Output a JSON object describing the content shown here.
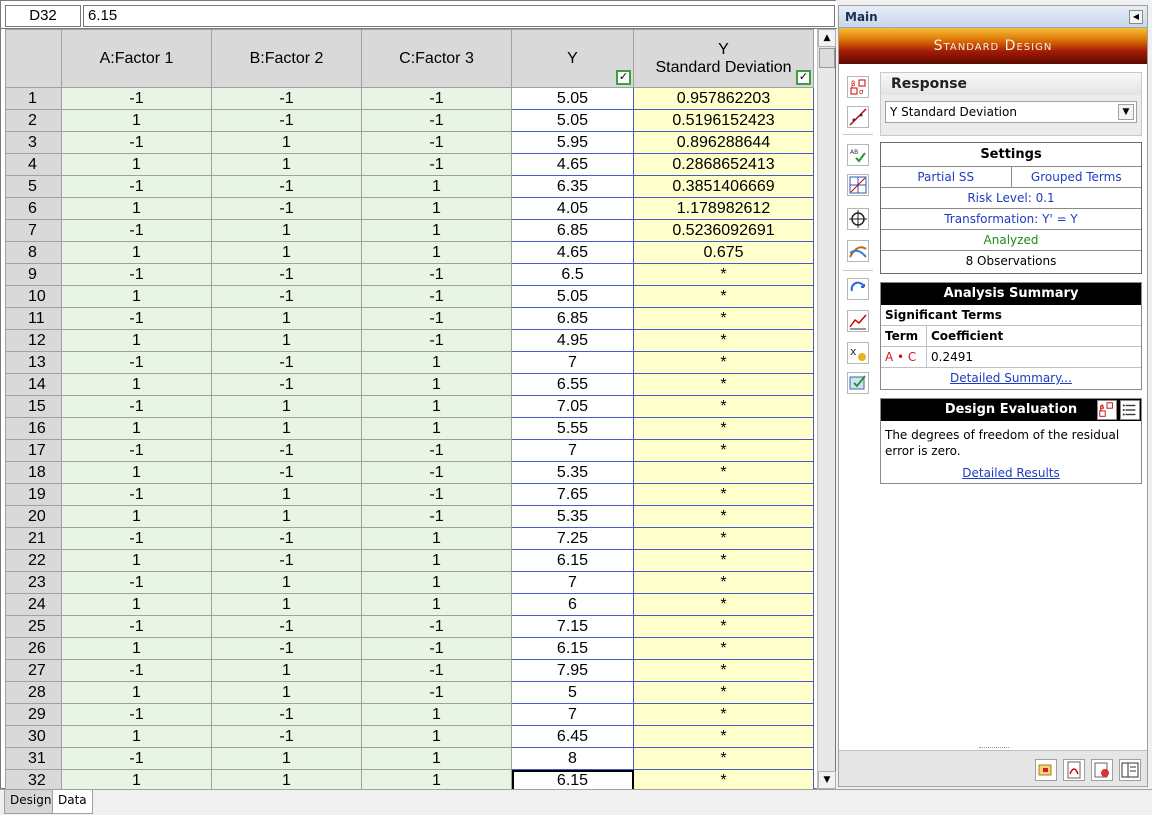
{
  "formula_bar": {
    "cell_ref": "D32",
    "value": "6.15"
  },
  "table": {
    "headers": {
      "a": "A:Factor 1",
      "b": "B:Factor 2",
      "c": "C:Factor 3",
      "y": "Y",
      "sd_line1": "Y",
      "sd_line2": "Standard Deviation"
    },
    "rows": [
      [
        "1",
        "-1",
        "-1",
        "-1",
        "5.05",
        "0.957862203"
      ],
      [
        "2",
        "1",
        "-1",
        "-1",
        "5.05",
        "0.5196152423"
      ],
      [
        "3",
        "-1",
        "1",
        "-1",
        "5.95",
        "0.896288644"
      ],
      [
        "4",
        "1",
        "1",
        "-1",
        "4.65",
        "0.2868652413"
      ],
      [
        "5",
        "-1",
        "-1",
        "1",
        "6.35",
        "0.3851406669"
      ],
      [
        "6",
        "1",
        "-1",
        "1",
        "4.05",
        "1.178982612"
      ],
      [
        "7",
        "-1",
        "1",
        "1",
        "6.85",
        "0.5236092691"
      ],
      [
        "8",
        "1",
        "1",
        "1",
        "4.65",
        "0.675"
      ],
      [
        "9",
        "-1",
        "-1",
        "-1",
        "6.5",
        "*"
      ],
      [
        "10",
        "1",
        "-1",
        "-1",
        "5.05",
        "*"
      ],
      [
        "11",
        "-1",
        "1",
        "-1",
        "6.85",
        "*"
      ],
      [
        "12",
        "1",
        "1",
        "-1",
        "4.95",
        "*"
      ],
      [
        "13",
        "-1",
        "-1",
        "1",
        "7",
        "*"
      ],
      [
        "14",
        "1",
        "-1",
        "1",
        "6.55",
        "*"
      ],
      [
        "15",
        "-1",
        "1",
        "1",
        "7.05",
        "*"
      ],
      [
        "16",
        "1",
        "1",
        "1",
        "5.55",
        "*"
      ],
      [
        "17",
        "-1",
        "-1",
        "-1",
        "7",
        "*"
      ],
      [
        "18",
        "1",
        "-1",
        "-1",
        "5.35",
        "*"
      ],
      [
        "19",
        "-1",
        "1",
        "-1",
        "7.65",
        "*"
      ],
      [
        "20",
        "1",
        "1",
        "-1",
        "5.35",
        "*"
      ],
      [
        "21",
        "-1",
        "-1",
        "1",
        "7.25",
        "*"
      ],
      [
        "22",
        "1",
        "-1",
        "1",
        "6.15",
        "*"
      ],
      [
        "23",
        "-1",
        "1",
        "1",
        "7",
        "*"
      ],
      [
        "24",
        "1",
        "1",
        "1",
        "6",
        "*"
      ],
      [
        "25",
        "-1",
        "-1",
        "-1",
        "7.15",
        "*"
      ],
      [
        "26",
        "1",
        "-1",
        "-1",
        "6.15",
        "*"
      ],
      [
        "27",
        "-1",
        "1",
        "-1",
        "7.95",
        "*"
      ],
      [
        "28",
        "1",
        "1",
        "-1",
        "5",
        "*"
      ],
      [
        "29",
        "-1",
        "-1",
        "1",
        "7",
        "*"
      ],
      [
        "30",
        "1",
        "-1",
        "1",
        "6.45",
        "*"
      ],
      [
        "31",
        "-1",
        "1",
        "1",
        "8",
        "*"
      ],
      [
        "32",
        "1",
        "1",
        "1",
        "6.15",
        "*"
      ]
    ]
  },
  "tabs": {
    "design": "Design",
    "data": "Data"
  },
  "panel": {
    "title": "Main",
    "banner": "Standard Design",
    "response": {
      "title": "Response",
      "selected": "Y Standard Deviation"
    },
    "settings": {
      "title": "Settings",
      "partial_ss": "Partial SS",
      "grouped_terms": "Grouped Terms",
      "risk_level": "Risk Level: 0.1",
      "transformation": "Transformation: Y' = Y",
      "status": "Analyzed",
      "observations": "8 Observations"
    },
    "analysis_summary": {
      "title": "Analysis Summary",
      "significant_terms": "Significant Terms",
      "col_term": "Term",
      "col_coefficient": "Coefficient",
      "term": "A • C",
      "coefficient": "0.2491",
      "link": "Detailed Summary..."
    },
    "design_evaluation": {
      "title": "Design Evaluation",
      "message": "The degrees of freedom of the residual error is zero.",
      "link": "Detailed Results"
    }
  },
  "colors": {
    "factor_bg": "#e8f5e5",
    "sd_bg": "#ffffcc",
    "link": "#1e3cc0",
    "analyzed": "#1f8a1f",
    "term_red": "#d51515"
  }
}
